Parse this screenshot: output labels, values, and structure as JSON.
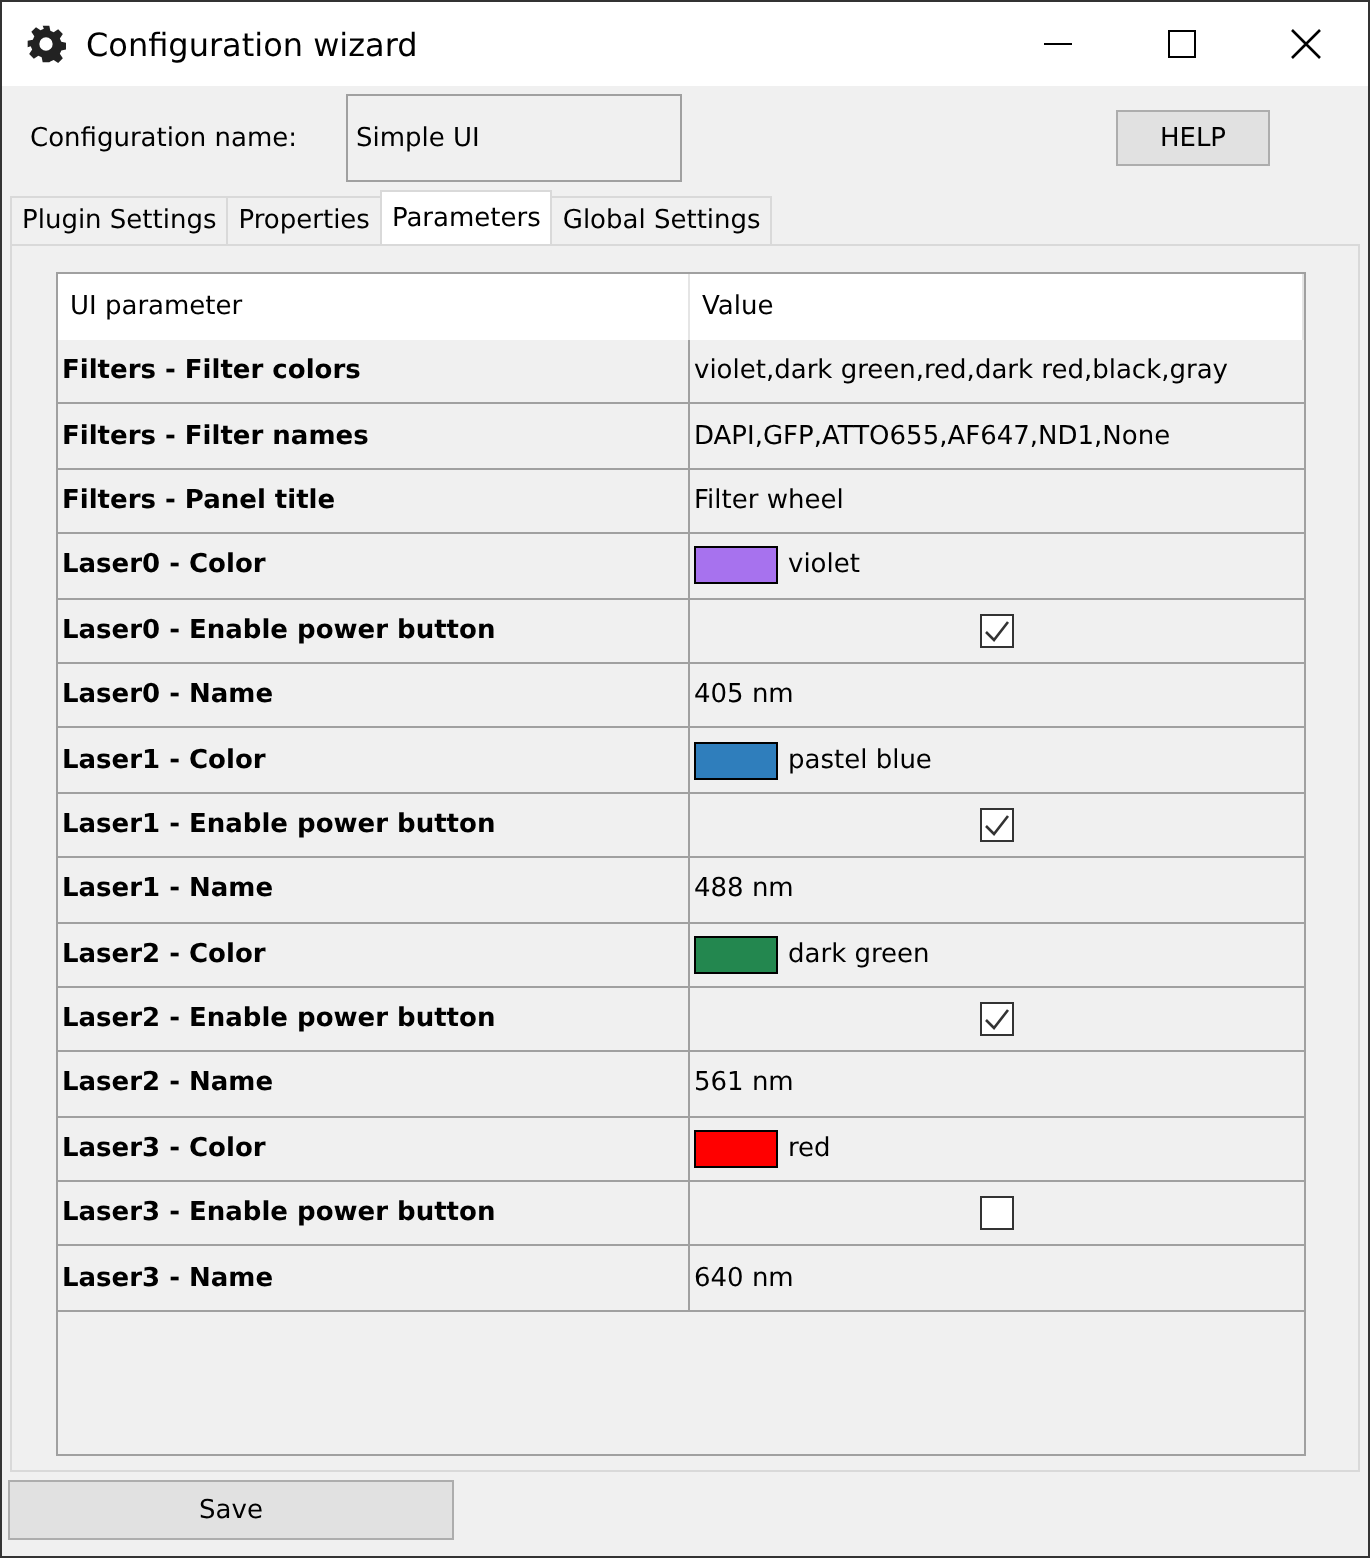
{
  "window": {
    "title": "Configuration wizard"
  },
  "config": {
    "label": "Configuration name:",
    "value": "Simple UI"
  },
  "help_button": "HELP",
  "tabs": [
    {
      "label": "Plugin Settings",
      "selected": false
    },
    {
      "label": "Properties",
      "selected": false
    },
    {
      "label": "Parameters",
      "selected": true
    },
    {
      "label": "Global Settings",
      "selected": false
    }
  ],
  "table": {
    "columns": [
      "UI parameter",
      "Value"
    ],
    "rows": [
      {
        "kind": "text",
        "parameter": "Filters - Filter colors",
        "value": "violet,dark green,red,dark red,black,gray"
      },
      {
        "kind": "text",
        "parameter": "Filters - Filter names",
        "value": "DAPI,GFP,ATTO655,AF647,ND1,None"
      },
      {
        "kind": "text",
        "parameter": "Filters - Panel title",
        "value": "Filter wheel"
      },
      {
        "kind": "color",
        "parameter": "Laser0 - Color",
        "value": "violet",
        "color": "#a772ee"
      },
      {
        "kind": "checkbox",
        "parameter": "Laser0 - Enable power button",
        "checked": true
      },
      {
        "kind": "text",
        "parameter": "Laser0 - Name",
        "value": "405 nm"
      },
      {
        "kind": "color",
        "parameter": "Laser1 - Color",
        "value": "pastel blue",
        "color": "#2f7ebc"
      },
      {
        "kind": "checkbox",
        "parameter": "Laser1 - Enable power button",
        "checked": true
      },
      {
        "kind": "text",
        "parameter": "Laser1 - Name",
        "value": "488 nm"
      },
      {
        "kind": "color",
        "parameter": "Laser2 - Color",
        "value": "dark green",
        "color": "#23874f"
      },
      {
        "kind": "checkbox",
        "parameter": "Laser2 - Enable power button",
        "checked": true
      },
      {
        "kind": "text",
        "parameter": "Laser2 - Name",
        "value": "561 nm"
      },
      {
        "kind": "color",
        "parameter": "Laser3 - Color",
        "value": "red",
        "color": "#ff0000"
      },
      {
        "kind": "checkbox",
        "parameter": "Laser3 - Enable power button",
        "checked": false
      },
      {
        "kind": "text",
        "parameter": "Laser3 - Name",
        "value": "640 nm"
      }
    ]
  },
  "save_button": "Save"
}
